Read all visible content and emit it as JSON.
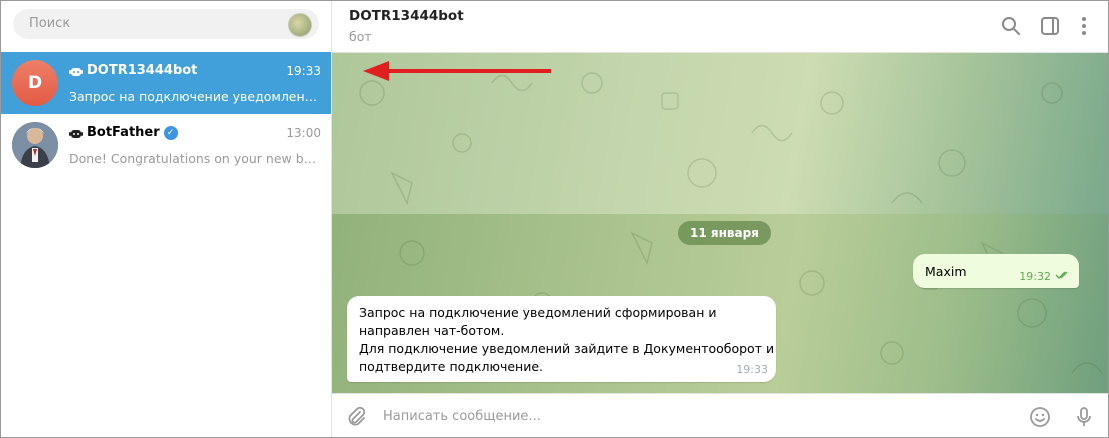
{
  "search": {
    "placeholder": "Поиск"
  },
  "chats": [
    {
      "avatar_letter": "D",
      "name": "DOTR13444bot",
      "time": "19:33",
      "preview": "Запрос на подключение уведомлений ...",
      "active": true
    },
    {
      "name": "BotFather",
      "time": "13:00",
      "preview": "Done! Congratulations on your new bot. ...",
      "verified": true,
      "active": false
    }
  ],
  "header": {
    "title": "DOTR13444bot",
    "subtitle": "бот"
  },
  "messages": {
    "date": "11 января",
    "outgoing": {
      "text": "Maxim",
      "time": "19:32",
      "status": "read"
    },
    "incoming": {
      "lines": [
        "Запрос на подключение уведомлений сформирован и",
        "направлен чат-ботом.",
        "Для подключение уведомлений зайдите в Документооборот и",
        "подтвердите подключение."
      ],
      "time": "19:33"
    }
  },
  "composer": {
    "placeholder": "Написать сообщение..."
  },
  "colors": {
    "accent": "#419fd9",
    "annotation_arrow": "#e02020"
  },
  "icons": [
    "bot-icon",
    "verified-icon",
    "search-icon",
    "sidebar-toggle-icon",
    "more-vertical-icon",
    "attach-icon",
    "emoji-icon",
    "microphone-icon"
  ]
}
